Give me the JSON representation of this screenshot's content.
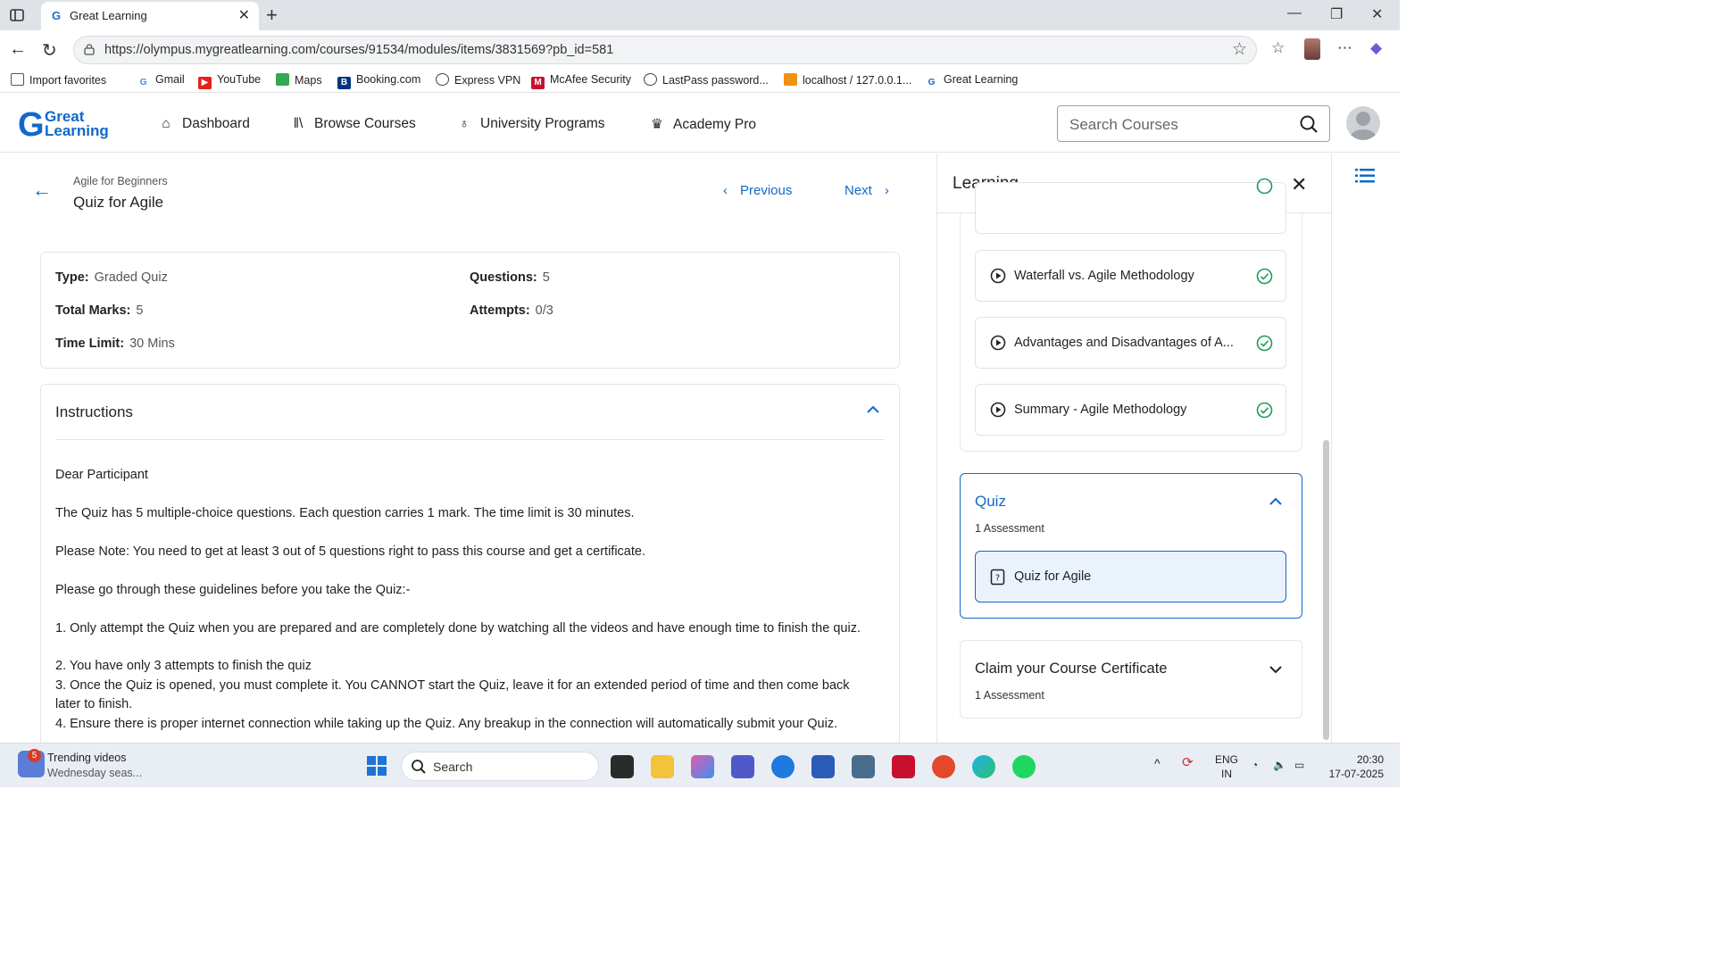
{
  "browser": {
    "tab_title": "Great Learning",
    "url": "https://olympus.mygreatlearning.com/courses/91534/modules/items/3831569?pb_id=581",
    "bookmarks": [
      "Import favorites",
      "Gmail",
      "YouTube",
      "Maps",
      "Booking.com",
      "Express VPN",
      "McAfee Security",
      "LastPass password...",
      "localhost / 127.0.0.1...",
      "Great Learning"
    ]
  },
  "header": {
    "logo_line1": "Great",
    "logo_line2": "Learning",
    "nav": [
      "Dashboard",
      "Browse Courses",
      "University Programs",
      "Academy Pro"
    ],
    "search_placeholder": "Search Courses"
  },
  "page": {
    "breadcrumb": "Agile for Beginners",
    "title": "Quiz for Agile",
    "prev_label": "Previous",
    "next_label": "Next"
  },
  "info": {
    "type_label": "Type:",
    "type_value": "Graded Quiz",
    "questions_label": "Questions:",
    "questions_value": "5",
    "marks_label": "Total Marks:",
    "marks_value": "5",
    "attempts_label": "Attempts:",
    "attempts_value": "0/3",
    "time_label": "Time Limit:",
    "time_value": "30 Mins"
  },
  "instructions": {
    "heading": "Instructions",
    "lines": [
      "Dear Participant",
      "The Quiz has 5 multiple-choice questions. Each question carries 1 mark. The time limit is 30 minutes.",
      "Please Note: You need to get at least 3 out of 5 questions right to pass this course and get a certificate.",
      "Please go through these guidelines before you take the Quiz:-",
      "1. Only attempt the Quiz when you are prepared and are completely done by watching all the videos and have enough time to finish the quiz.",
      "2. You have only 3 attempts to finish the quiz",
      "3. Once the Quiz is opened, you must complete it. You CANNOT start the Quiz, leave it for an extended period of time and then come back later to finish.",
      "4. Ensure there is proper internet connection while taking up the Quiz. Any breakup in the connection will automatically submit your Quiz."
    ]
  },
  "panel": {
    "title": "Learning",
    "lessons": [
      "Waterfall vs. Agile Methodology",
      "Advantages and Disadvantages of A...",
      "Summary - Agile Methodology"
    ],
    "quiz_title": "Quiz",
    "quiz_sub": "1 Assessment",
    "quiz_item": "Quiz for Agile",
    "cert_title": "Claim your Course Certificate",
    "cert_sub": "1 Assessment"
  },
  "taskbar": {
    "news_badge": "5",
    "news_title": "Trending videos",
    "news_sub": "Wednesday seas...",
    "search": "Search",
    "lang1": "ENG",
    "lang2": "IN",
    "time": "20:30",
    "date": "17-07-2025"
  },
  "colors": {
    "accent": "#1268c9",
    "success": "#1a9b5c"
  }
}
